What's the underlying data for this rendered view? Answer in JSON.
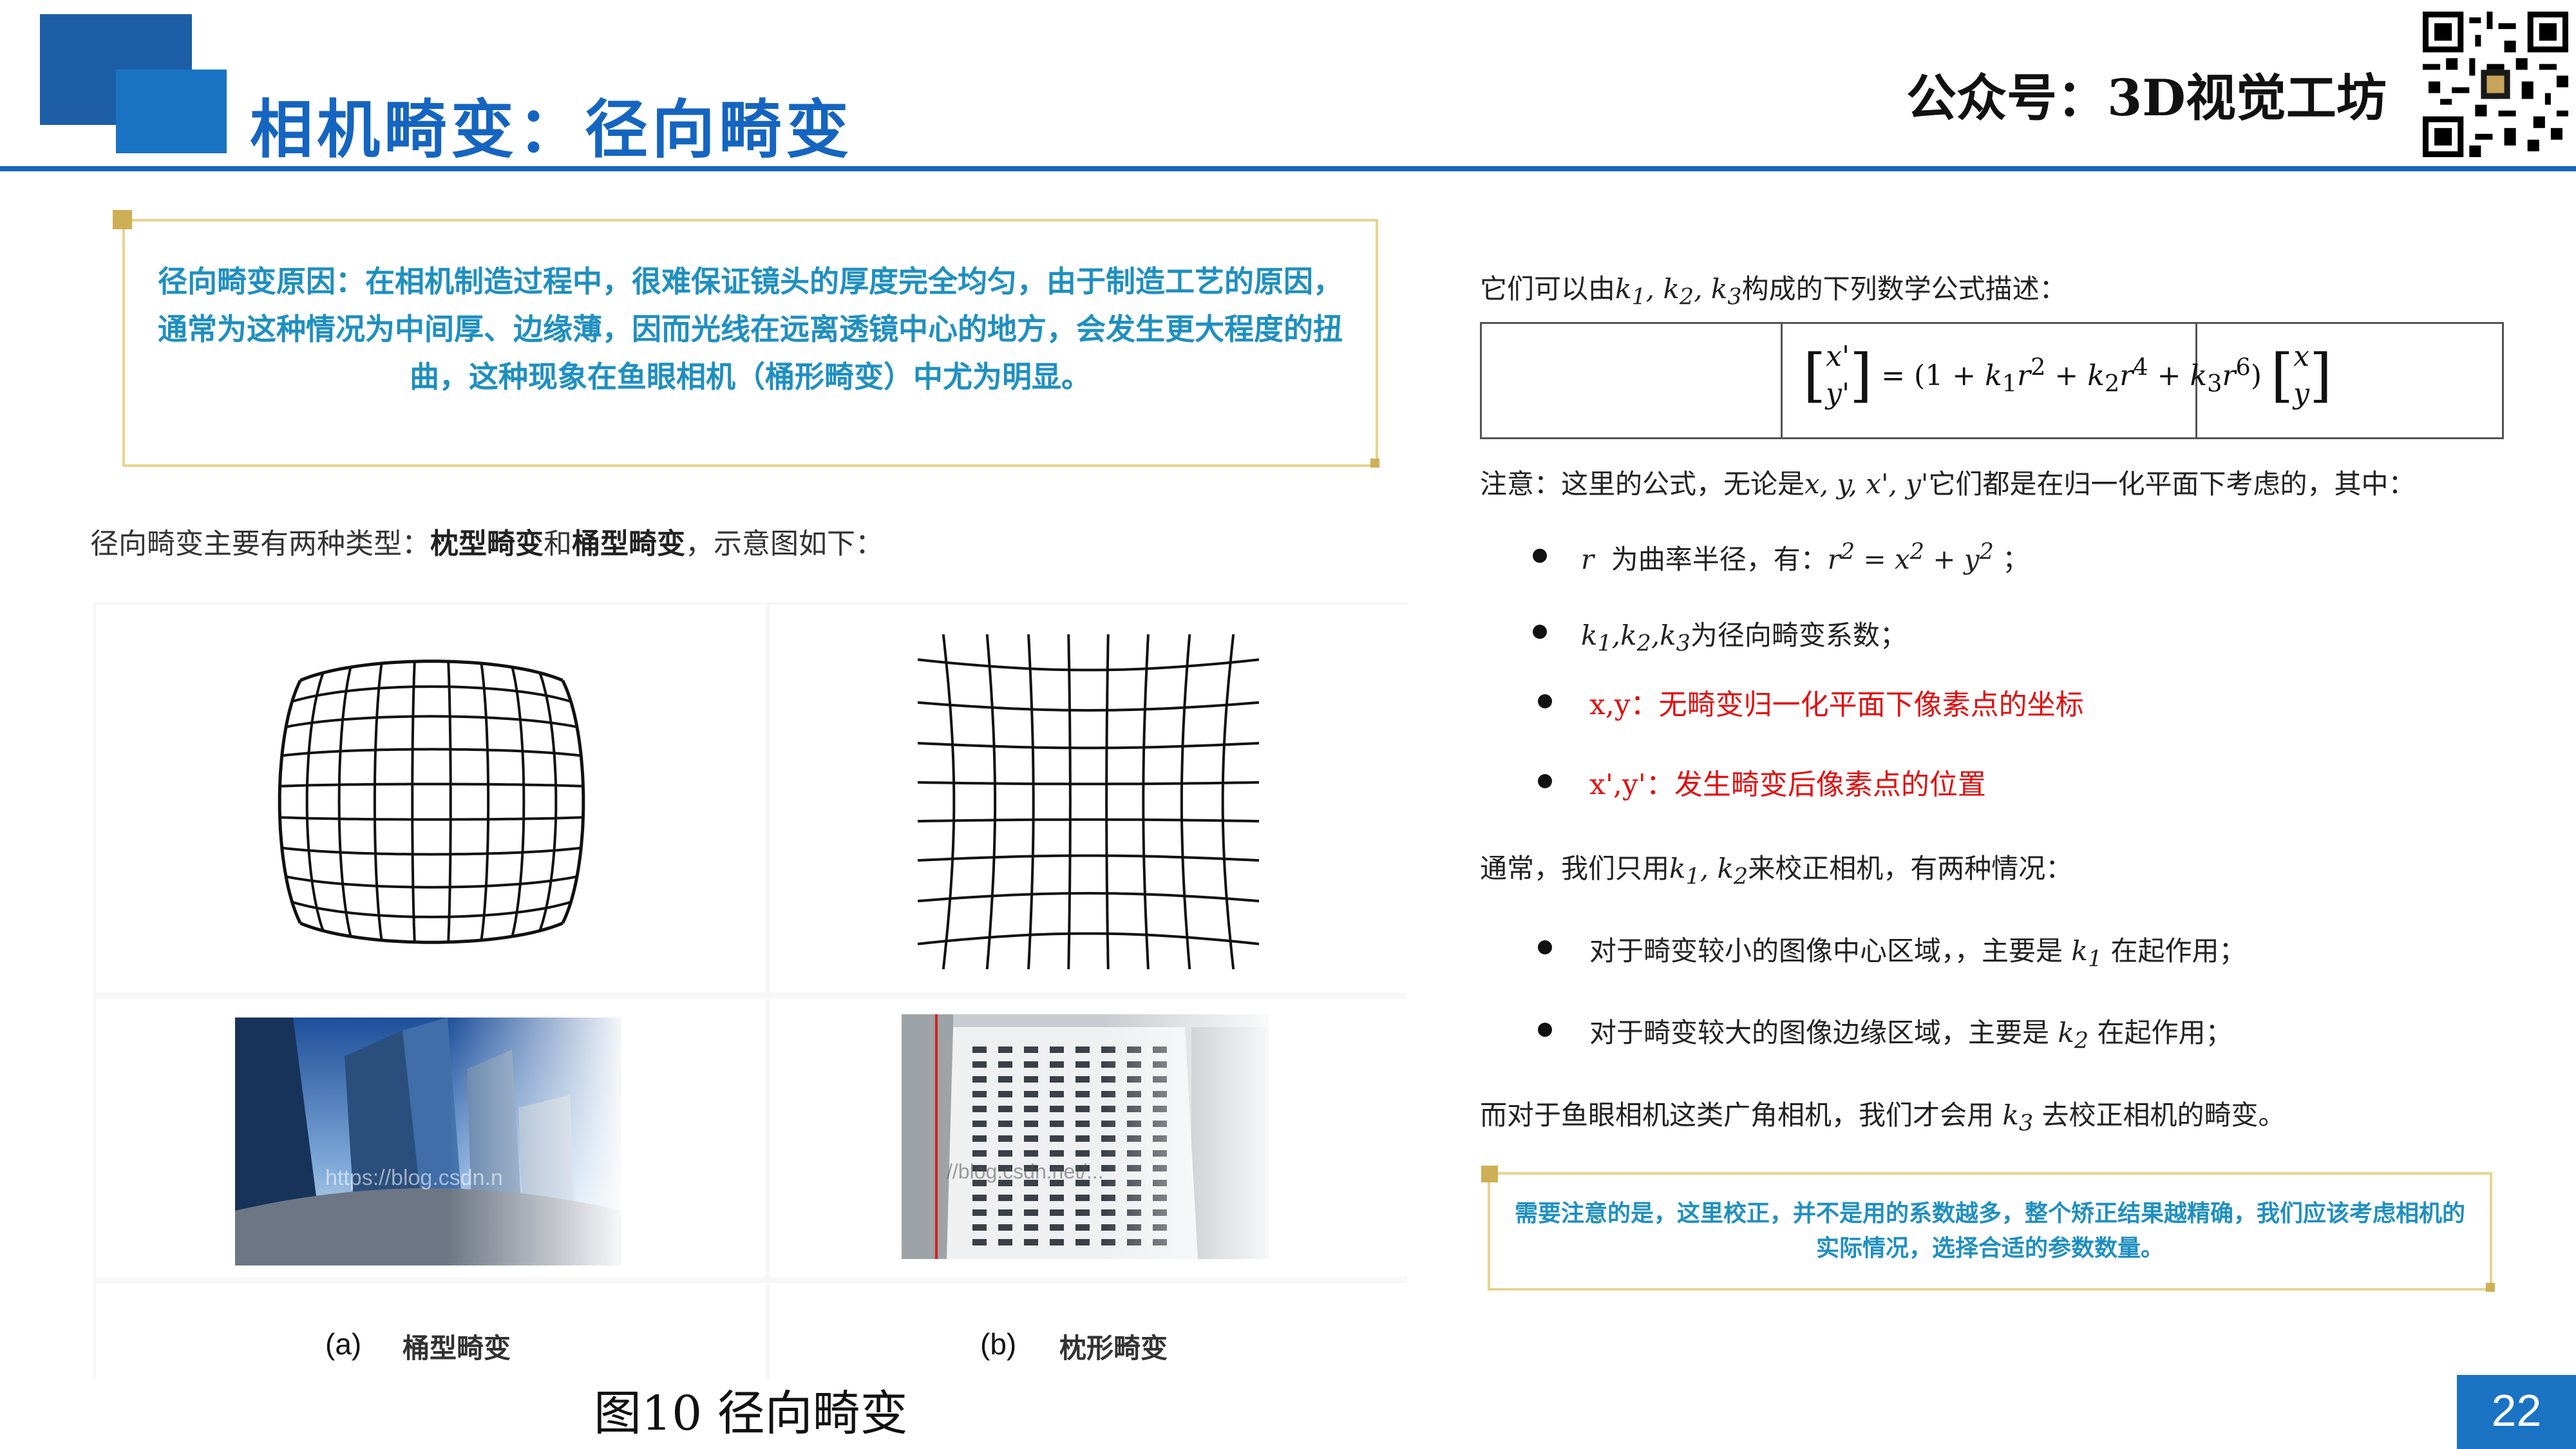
{
  "header": {
    "title": "相机畸变：径向畸变",
    "brand": "公众号：3D视觉工坊"
  },
  "left": {
    "note": "径向畸变原因：在相机制造过程中，很难保证镜头的厚度完全均匀，由于制造工艺的原因，通常为这种情况为中间厚、边缘薄，因而光线在远离透镜中心的地方，会发生更大程度的扭曲，这种现象在鱼眼相机（桶形畸变）中尤为明显。",
    "intro_prefix": "径向畸变主要有两种类型：",
    "intro_bold1": "枕型畸变",
    "intro_and": "和",
    "intro_bold2": "桶型畸变",
    "intro_suffix": "，示意图如下：",
    "caption_a_label": "(a)",
    "caption_a_name": "桶型畸变",
    "caption_b_label": "(b)",
    "caption_b_name": "枕形畸变",
    "figure_title": "图10 径向畸变",
    "watermark_a": "https://blog.csdn.n",
    "watermark_b": "//blog.csdn.net/..."
  },
  "right": {
    "line1_pre": "它们可以由",
    "line1_post": "构成的下列数学公式描述：",
    "note_pre": "注意：这里的公式，无论是",
    "note_post": "它们都是在归一化平面下考虑的，其中：",
    "b1_a": "为曲率半径，有：",
    "b2": "为径向畸变系数；",
    "b3": "x,y：无畸变归一化平面下像素点的坐标",
    "b4": "x',y'：发生畸变后像素点的位置",
    "usual_pre": "通常，我们只用",
    "usual_post": "来校正相机，有两种情况：",
    "c1_pre": "对于畸变较小的图像中心区域，，主要是",
    "c1_post": "在起作用；",
    "c2_pre": "对于畸变较大的图像边缘区域，主要是",
    "c2_post": "在起作用；",
    "fisheye_pre": "而对于鱼眼相机这类广角相机，我们才会用",
    "fisheye_post": "去校正相机的畸变。",
    "note2": "需要注意的是，这里校正，并不是用的系数越多，整个矫正结果越精确，我们应该考虑相机的实际情况，选择合适的参数数量。"
  },
  "page_number": "22"
}
